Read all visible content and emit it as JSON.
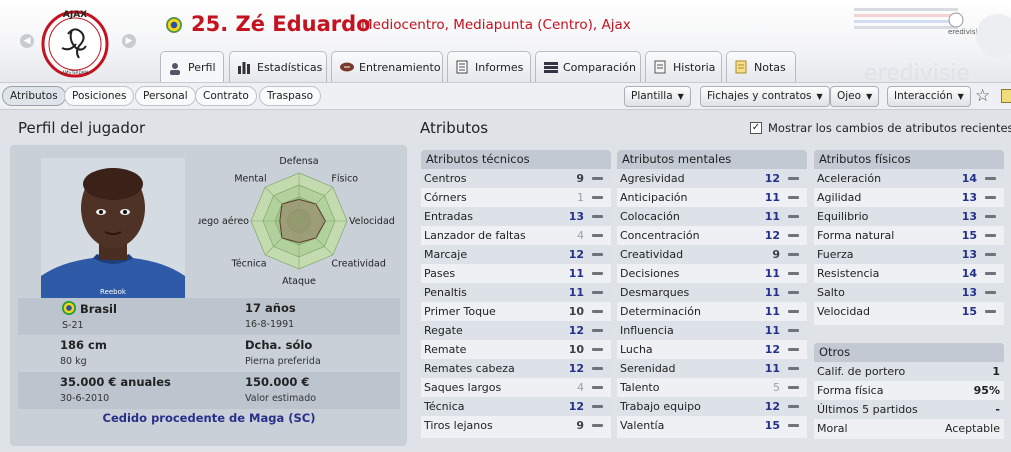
{
  "header": {
    "player_name": "25. Zé Eduardo",
    "player_role": "Mediocentro, Mediapunta (Centro), Ajax",
    "club_logo_text": "AJAX",
    "club_logo_subtext": "AMSTERDAM",
    "league_logo_text": "eredivisie",
    "league_watermark": "eredivisie"
  },
  "tabs": [
    {
      "label": "Perfil",
      "icon": "profile-icon",
      "active": true
    },
    {
      "label": "Estadísticas",
      "icon": "stats-icon"
    },
    {
      "label": "Entrenamiento",
      "icon": "ball-icon"
    },
    {
      "label": "Informes",
      "icon": "report-icon"
    },
    {
      "label": "Comparación",
      "icon": "compare-icon"
    },
    {
      "label": "Historia",
      "icon": "history-icon"
    },
    {
      "label": "Notas",
      "icon": "notes-icon"
    }
  ],
  "subtabs": [
    "Atributos",
    "Posiciones",
    "Personal",
    "Contrato",
    "Traspaso"
  ],
  "toolbar_buttons": [
    "Plantilla",
    "Fichajes y contratos",
    "Ojeo",
    "Interacción"
  ],
  "profile": {
    "title": "Perfil del jugador",
    "photo_brand": "Reebok",
    "radar_labels": [
      "Defensa",
      "Físico",
      "Velocidad",
      "Creatividad",
      "Ataque",
      "Técnica",
      "Juego aéreo",
      "Mental"
    ],
    "radar_values": [
      0.45,
      0.5,
      0.55,
      0.5,
      0.45,
      0.5,
      0.4,
      0.5
    ],
    "nationality": "Brasil",
    "nationality_sub": "S-21",
    "age": "17 años",
    "birth_date": "16-8-1991",
    "height": "186 cm",
    "weight": "80 kg",
    "foot": "Dcha. sólo",
    "foot_label": "Pierna preferida",
    "wage": "35.000 € anuales",
    "contract_end": "30-6-2010",
    "value": "150.000 €",
    "value_label": "Valor estimado",
    "loan": "Cedido procedente de Maga (SC)"
  },
  "attributes": {
    "title": "Atributos",
    "recent_changes_label": "Mostrar los cambios de atributos recientes",
    "technical": {
      "header": "Atributos técnicos",
      "rows": [
        {
          "name": "Centros",
          "value": "9"
        },
        {
          "name": "Córners",
          "value": "1"
        },
        {
          "name": "Entradas",
          "value": "13"
        },
        {
          "name": "Lanzador de faltas",
          "value": "4"
        },
        {
          "name": "Marcaje",
          "value": "12"
        },
        {
          "name": "Pases",
          "value": "11"
        },
        {
          "name": "Penaltis",
          "value": "11"
        },
        {
          "name": "Primer Toque",
          "value": "10"
        },
        {
          "name": "Regate",
          "value": "12"
        },
        {
          "name": "Remate",
          "value": "10"
        },
        {
          "name": "Remates cabeza",
          "value": "12"
        },
        {
          "name": "Saques largos",
          "value": "4"
        },
        {
          "name": "Técnica",
          "value": "12"
        },
        {
          "name": "Tiros lejanos",
          "value": "9"
        }
      ]
    },
    "mental": {
      "header": "Atributos mentales",
      "rows": [
        {
          "name": "Agresividad",
          "value": "12"
        },
        {
          "name": "Anticipación",
          "value": "11"
        },
        {
          "name": "Colocación",
          "value": "11"
        },
        {
          "name": "Concentración",
          "value": "12"
        },
        {
          "name": "Creatividad",
          "value": "9"
        },
        {
          "name": "Decisiones",
          "value": "11"
        },
        {
          "name": "Desmarques",
          "value": "11"
        },
        {
          "name": "Determinación",
          "value": "11"
        },
        {
          "name": "Influencia",
          "value": "11"
        },
        {
          "name": "Lucha",
          "value": "12"
        },
        {
          "name": "Serenidad",
          "value": "11"
        },
        {
          "name": "Talento",
          "value": "5"
        },
        {
          "name": "Trabajo equipo",
          "value": "12"
        },
        {
          "name": "Valentía",
          "value": "15"
        }
      ]
    },
    "physical": {
      "header": "Atributos físicos",
      "rows": [
        {
          "name": "Aceleración",
          "value": "14"
        },
        {
          "name": "Agilidad",
          "value": "13"
        },
        {
          "name": "Equilibrio",
          "value": "13"
        },
        {
          "name": "Forma natural",
          "value": "15"
        },
        {
          "name": "Fuerza",
          "value": "13"
        },
        {
          "name": "Resistencia",
          "value": "14"
        },
        {
          "name": "Salto",
          "value": "13"
        },
        {
          "name": "Velocidad",
          "value": "15"
        }
      ]
    },
    "others": {
      "header": "Otros",
      "rows": [
        {
          "name": "Calif. de portero",
          "value": "1"
        },
        {
          "name": "Forma física",
          "value": "95%"
        },
        {
          "name": "Últimos 5 partidos",
          "value": "-"
        },
        {
          "name": "Moral",
          "value": "Aceptable"
        }
      ]
    }
  },
  "colors": {
    "accent_red": "#c4121f",
    "attr_blue": "#24308a",
    "panel_bg": "#eef0f3"
  }
}
